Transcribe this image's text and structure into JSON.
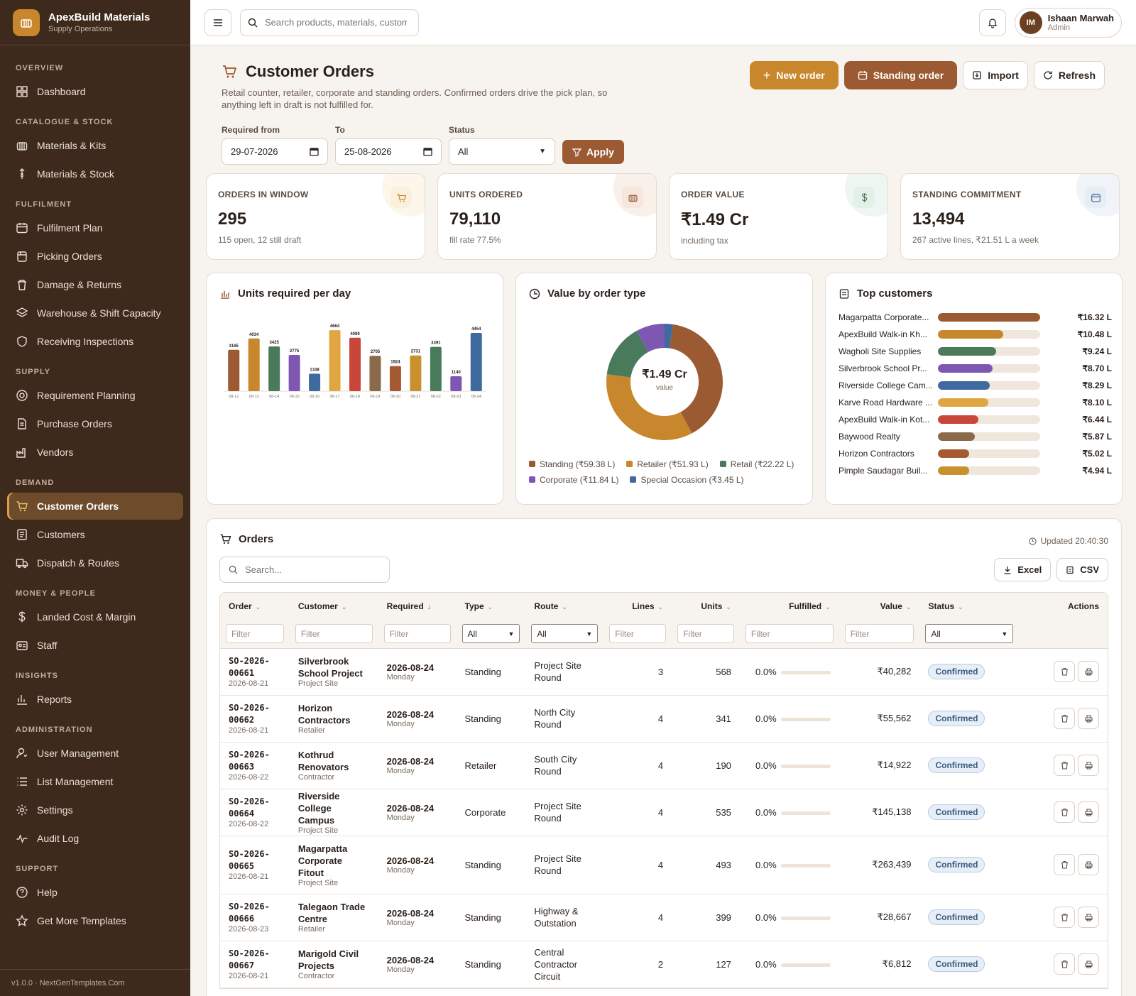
{
  "app": {
    "name": "ApexBuild Materials",
    "subtitle": "Supply Operations",
    "version": "v1.0.0 · NextGenTemplates.Com"
  },
  "nav": [
    {
      "section": "OVERVIEW",
      "items": [
        {
          "label": "Dashboard",
          "icon": "grid-icon"
        }
      ]
    },
    {
      "section": "CATALOGUE & STOCK",
      "items": [
        {
          "label": "Materials & Kits",
          "icon": "kit-icon"
        },
        {
          "label": "Materials & Stock",
          "icon": "stock-icon"
        }
      ]
    },
    {
      "section": "FULFILMENT",
      "items": [
        {
          "label": "Fulfilment Plan",
          "icon": "calendar-icon"
        },
        {
          "label": "Picking Orders",
          "icon": "clipboard-icon"
        },
        {
          "label": "Damage & Returns",
          "icon": "trash-icon"
        },
        {
          "label": "Warehouse & Shift Capacity",
          "icon": "layers-icon"
        },
        {
          "label": "Receiving Inspections",
          "icon": "shield-icon"
        }
      ]
    },
    {
      "section": "SUPPLY",
      "items": [
        {
          "label": "Requirement Planning",
          "icon": "target-icon"
        },
        {
          "label": "Purchase Orders",
          "icon": "document-icon"
        },
        {
          "label": "Vendors",
          "icon": "factory-icon"
        }
      ]
    },
    {
      "section": "DEMAND",
      "items": [
        {
          "label": "Customer Orders",
          "icon": "cart-icon",
          "active": true
        },
        {
          "label": "Customers",
          "icon": "contacts-icon"
        },
        {
          "label": "Dispatch & Routes",
          "icon": "truck-icon"
        }
      ]
    },
    {
      "section": "MONEY & PEOPLE",
      "items": [
        {
          "label": "Landed Cost & Margin",
          "icon": "dollar-icon"
        },
        {
          "label": "Staff",
          "icon": "id-card-icon"
        }
      ]
    },
    {
      "section": "INSIGHTS",
      "items": [
        {
          "label": "Reports",
          "icon": "bar-chart-icon"
        }
      ]
    },
    {
      "section": "ADMINISTRATION",
      "items": [
        {
          "label": "User Management",
          "icon": "user-icon"
        },
        {
          "label": "List Management",
          "icon": "list-icon"
        },
        {
          "label": "Settings",
          "icon": "gear-icon"
        },
        {
          "label": "Audit Log",
          "icon": "pulse-icon"
        }
      ]
    },
    {
      "section": "SUPPORT",
      "items": [
        {
          "label": "Help",
          "icon": "help-icon"
        },
        {
          "label": "Get More Templates",
          "icon": "star-icon"
        }
      ]
    }
  ],
  "topbar": {
    "search_placeholder": "Search products, materials, customers...",
    "user_initials": "IM",
    "user_name": "Ishaan Marwah",
    "user_role": "Admin"
  },
  "page": {
    "title": "Customer Orders",
    "description": "Retail counter, retailer, corporate and standing orders. Confirmed orders drive the pick plan, so anything left in draft is not fulfilled for.",
    "actions": {
      "new_order": "New order",
      "standing_order": "Standing order",
      "import": "Import",
      "refresh": "Refresh"
    }
  },
  "filters": {
    "from_label": "Required from",
    "from_value": "29-07-2026",
    "to_label": "To",
    "to_value": "25-08-2026",
    "status_label": "Status",
    "status_value": "All",
    "apply": "Apply"
  },
  "kpis": [
    {
      "label": "ORDERS IN WINDOW",
      "value": "295",
      "sub": "115 open, 12 still draft",
      "icon": "cart-icon",
      "color": "#c8872d",
      "bg": "#fbf0dd"
    },
    {
      "label": "UNITS ORDERED",
      "value": "79,110",
      "sub": "fill rate 77.5%",
      "icon": "kit-icon",
      "color": "#9b5a32",
      "bg": "#f6e6dc"
    },
    {
      "label": "ORDER VALUE",
      "value": "₹1.49 Cr",
      "sub": "including tax",
      "icon": "dollar-icon",
      "color": "#4a7a5c",
      "bg": "#e3f0e7"
    },
    {
      "label": "STANDING COMMITMENT",
      "value": "13,494",
      "sub": "267 active lines, ₹21.51 L a week",
      "icon": "calendar-icon",
      "color": "#4a6a90",
      "bg": "#e6edf5"
    }
  ],
  "units_panel": {
    "title": "Units required per day"
  },
  "chart_data": [
    {
      "type": "bar",
      "title": "Units required per day",
      "categories": [
        "08-12",
        "08-13",
        "08-14",
        "08-15",
        "08-16",
        "08-17",
        "08-18",
        "08-19",
        "08-20",
        "08-21",
        "08-22",
        "08-23",
        "08-24"
      ],
      "values": [
        3165,
        4034,
        3425,
        2775,
        1338,
        4664,
        4089,
        2705,
        1924,
        2731,
        3391,
        1140,
        4454
      ],
      "colors": [
        "#9b5a32",
        "#c8872d",
        "#4a7a5c",
        "#7e57b2",
        "#3f6aa0",
        "#e0a640",
        "#c8473a",
        "#8a6a4a",
        "#a65a32",
        "#c8912d",
        "#4a7a5c",
        "#7e57b2",
        "#3f6aa0"
      ],
      "ylim": [
        0,
        5000
      ]
    },
    {
      "type": "pie",
      "title": "Value by order type",
      "center_value": "₹1.49 Cr",
      "center_label": "value",
      "slices": [
        {
          "name": "Standing",
          "label": "Standing (₹59.38 L)",
          "value": 59.38,
          "color": "#9b5a32"
        },
        {
          "name": "Retailer",
          "label": "Retailer (₹51.93 L)",
          "value": 51.93,
          "color": "#c8872d"
        },
        {
          "name": "Retail",
          "label": "Retail (₹22.22 L)",
          "value": 22.22,
          "color": "#4a7a5c"
        },
        {
          "name": "Corporate",
          "label": "Corporate (₹11.84 L)",
          "value": 11.84,
          "color": "#7e57b2"
        },
        {
          "name": "Special Occasion",
          "label": "Special Occasion (₹3.45 L)",
          "value": 3.45,
          "color": "#3f6aa0"
        }
      ]
    },
    {
      "type": "bar",
      "title": "Top customers",
      "categories": [
        "Magarpatta Corporate...",
        "ApexBuild Walk-in Kh...",
        "Wagholi Site Supplies",
        "Silverbrook School Pr...",
        "Riverside College Cam...",
        "Karve Road Hardware ...",
        "ApexBuild Walk-in Kot...",
        "Baywood Realty",
        "Horizon Contractors",
        "Pimple Saudagar Buil..."
      ],
      "values": [
        16.32,
        10.48,
        9.24,
        8.7,
        8.29,
        8.1,
        6.44,
        5.87,
        5.02,
        4.94
      ],
      "labels": [
        "₹16.32 L",
        "₹10.48 L",
        "₹9.24 L",
        "₹8.70 L",
        "₹8.29 L",
        "₹8.10 L",
        "₹6.44 L",
        "₹5.87 L",
        "₹5.02 L",
        "₹4.94 L"
      ],
      "colors": [
        "#9b5a32",
        "#c8872d",
        "#4a7a5c",
        "#7e57b2",
        "#3f6aa0",
        "#e0a640",
        "#c8473a",
        "#8a6a4a",
        "#a65a32",
        "#c8912d"
      ]
    }
  ],
  "orders": {
    "title": "Orders",
    "updated": "Updated 20:40:30",
    "search_placeholder": "Search...",
    "export_excel": "Excel",
    "export_csv": "CSV",
    "columns": [
      "Order",
      "Customer",
      "Required",
      "Type",
      "Route",
      "Lines",
      "Units",
      "Fulfilled",
      "Value",
      "Status",
      "Actions"
    ],
    "filter_placeholder": "Filter",
    "select_all": "All",
    "rows": [
      {
        "id_a": "SO-2026-",
        "id_b": "00661",
        "date": "2026-08-21",
        "customer": "Silverbrook School Project",
        "ctype": "Project Site",
        "req": "2026-08-24",
        "day": "Monday",
        "type": "Standing",
        "route": "Project Site Round",
        "lines": "3",
        "units": "568",
        "fulfilled": "0.0%",
        "value": "₹40,282",
        "status": "Confirmed"
      },
      {
        "id_a": "SO-2026-",
        "id_b": "00662",
        "date": "2026-08-21",
        "customer": "Horizon Contractors",
        "ctype": "Retailer",
        "req": "2026-08-24",
        "day": "Monday",
        "type": "Standing",
        "route": "North City Round",
        "lines": "4",
        "units": "341",
        "fulfilled": "0.0%",
        "value": "₹55,562",
        "status": "Confirmed"
      },
      {
        "id_a": "SO-2026-",
        "id_b": "00663",
        "date": "2026-08-22",
        "customer": "Kothrud Renovators",
        "ctype": "Contractor",
        "req": "2026-08-24",
        "day": "Monday",
        "type": "Retailer",
        "route": "South City Round",
        "lines": "4",
        "units": "190",
        "fulfilled": "0.0%",
        "value": "₹14,922",
        "status": "Confirmed"
      },
      {
        "id_a": "SO-2026-",
        "id_b": "00664",
        "date": "2026-08-22",
        "customer": "Riverside College Campus",
        "ctype": "Project Site",
        "req": "2026-08-24",
        "day": "Monday",
        "type": "Corporate",
        "route": "Project Site Round",
        "lines": "4",
        "units": "535",
        "fulfilled": "0.0%",
        "value": "₹145,138",
        "status": "Confirmed"
      },
      {
        "id_a": "SO-2026-",
        "id_b": "00665",
        "date": "2026-08-21",
        "customer": "Magarpatta Corporate Fitout",
        "ctype": "Project Site",
        "req": "2026-08-24",
        "day": "Monday",
        "type": "Standing",
        "route": "Project Site Round",
        "lines": "4",
        "units": "493",
        "fulfilled": "0.0%",
        "value": "₹263,439",
        "status": "Confirmed"
      },
      {
        "id_a": "SO-2026-",
        "id_b": "00666",
        "date": "2026-08-23",
        "customer": "Talegaon Trade Centre",
        "ctype": "Retailer",
        "req": "2026-08-24",
        "day": "Monday",
        "type": "Standing",
        "route": "Highway & Outstation",
        "lines": "4",
        "units": "399",
        "fulfilled": "0.0%",
        "value": "₹28,667",
        "status": "Confirmed"
      },
      {
        "id_a": "SO-2026-",
        "id_b": "00667",
        "date": "2026-08-21",
        "customer": "Marigold Civil Projects",
        "ctype": "Contractor",
        "req": "2026-08-24",
        "day": "Monday",
        "type": "Standing",
        "route": "Central Contractor Circuit",
        "lines": "2",
        "units": "127",
        "fulfilled": "0.0%",
        "value": "₹6,812",
        "status": "Confirmed"
      }
    ]
  }
}
